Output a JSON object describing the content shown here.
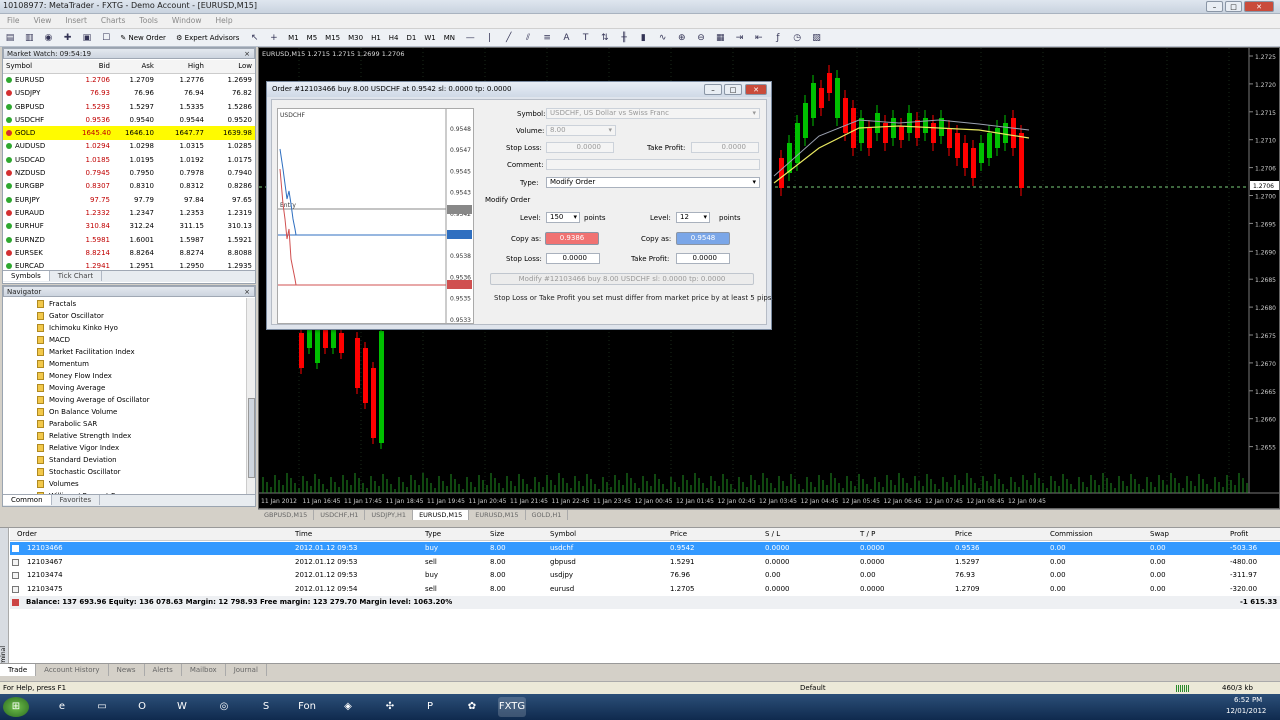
{
  "window": {
    "title": "10108977: MetaTrader - FXTG - Demo Account - [EURUSD,M15]"
  },
  "menu": [
    "File",
    "View",
    "Insert",
    "Charts",
    "Tools",
    "Window",
    "Help"
  ],
  "toolbar": {
    "new_order": "New Order",
    "expert_advisors": "Expert Advisors",
    "timeframes": [
      "M1",
      "M5",
      "M15",
      "M30",
      "H1",
      "H4",
      "D1",
      "W1",
      "MN"
    ]
  },
  "market_watch": {
    "title": "Market Watch: 09:54:19",
    "columns": [
      "Symbol",
      "Bid",
      "Ask",
      "High",
      "Low"
    ],
    "rows": [
      {
        "symbol": "EURUSD",
        "bid": "1.2706",
        "ask": "1.2709",
        "high": "1.2776",
        "low": "1.2699"
      },
      {
        "symbol": "USDJPY",
        "bid": "76.93",
        "ask": "76.96",
        "high": "76.94",
        "low": "76.82"
      },
      {
        "symbol": "GBPUSD",
        "bid": "1.5293",
        "ask": "1.5297",
        "high": "1.5335",
        "low": "1.5286"
      },
      {
        "symbol": "USDCHF",
        "bid": "0.9536",
        "ask": "0.9540",
        "high": "0.9544",
        "low": "0.9520"
      },
      {
        "symbol": "GOLD",
        "bid": "1645.40",
        "ask": "1646.10",
        "high": "1647.77",
        "low": "1639.98"
      },
      {
        "symbol": "AUDUSD",
        "bid": "1.0294",
        "ask": "1.0298",
        "high": "1.0315",
        "low": "1.0285"
      },
      {
        "symbol": "USDCAD",
        "bid": "1.0185",
        "ask": "1.0195",
        "high": "1.0192",
        "low": "1.0175"
      },
      {
        "symbol": "NZDUSD",
        "bid": "0.7945",
        "ask": "0.7950",
        "high": "0.7978",
        "low": "0.7940"
      },
      {
        "symbol": "EURGBP",
        "bid": "0.8307",
        "ask": "0.8310",
        "high": "0.8312",
        "low": "0.8286"
      },
      {
        "symbol": "EURJPY",
        "bid": "97.75",
        "ask": "97.79",
        "high": "97.84",
        "low": "97.65"
      },
      {
        "symbol": "EURAUD",
        "bid": "1.2332",
        "ask": "1.2347",
        "high": "1.2353",
        "low": "1.2319"
      },
      {
        "symbol": "EURHUF",
        "bid": "310.84",
        "ask": "312.24",
        "high": "311.15",
        "low": "310.13"
      },
      {
        "symbol": "EURNZD",
        "bid": "1.5981",
        "ask": "1.6001",
        "high": "1.5987",
        "low": "1.5921"
      },
      {
        "symbol": "EURSEK",
        "bid": "8.8214",
        "ask": "8.8264",
        "high": "8.8274",
        "low": "8.8088"
      },
      {
        "symbol": "EURCAD",
        "bid": "1.2941",
        "ask": "1.2951",
        "high": "1.2950",
        "low": "1.2935"
      }
    ],
    "tabs": [
      "Symbols",
      "Tick Chart"
    ]
  },
  "navigator": {
    "title": "Navigator",
    "items": [
      "Fractals",
      "Gator Oscillator",
      "Ichimoku Kinko Hyo",
      "MACD",
      "Market Facilitation Index",
      "Momentum",
      "Money Flow Index",
      "Moving Average",
      "Moving Average of Oscillator",
      "On Balance Volume",
      "Parabolic SAR",
      "Relative Strength Index",
      "Relative Vigor Index",
      "Standard Deviation",
      "Stochastic Oscillator",
      "Volumes",
      "Williams' Percent Range",
      "Expert Advisors"
    ],
    "tabs": [
      "Common",
      "Favorites"
    ]
  },
  "chart": {
    "title": "EURUSD,M15  1.2715 1.2715 1.2699 1.2706",
    "price_labels": [
      "1.2725",
      "1.2720",
      "1.2715",
      "1.2710",
      "1.2706",
      "1.2700",
      "1.2695",
      "1.2690",
      "1.2685",
      "1.2680",
      "1.2675",
      "1.2670",
      "1.2665",
      "1.2660",
      "1.2655"
    ],
    "time_labels": [
      "11 Jan 2012",
      "11 Jan 16:45",
      "11 Jan 17:45",
      "11 Jan 18:45",
      "11 Jan 19:45",
      "11 Jan 20:45",
      "11 Jan 21:45",
      "11 Jan 22:45",
      "11 Jan 23:45",
      "12 Jan 00:45",
      "12 Jan 01:45",
      "12 Jan 02:45",
      "12 Jan 03:45",
      "12 Jan 04:45",
      "12 Jan 05:45",
      "12 Jan 06:45",
      "12 Jan 07:45",
      "12 Jan 08:45",
      "12 Jan 09:45"
    ],
    "tabs": [
      "GBPUSD,M15",
      "USDCHF,H1",
      "USDJPY,H1",
      "EURUSD,M15",
      "EURUSD,M15",
      "GOLD,H1"
    ],
    "active_tab": 3
  },
  "dialog": {
    "title": "Order #12103466 buy 8.00 USDCHF at 0.9542 sl: 0.0000 tp: 0.0000",
    "symbol_label": "Symbol:",
    "symbol_value": "USDCHF, US Dollar vs Swiss Franc",
    "volume_label": "Volume:",
    "volume_value": "8.00",
    "stoploss_label": "Stop Loss:",
    "stoploss_value": "0.0000",
    "takeprofit_label": "Take Profit:",
    "takeprofit_value": "0.0000",
    "comment_label": "Comment:",
    "type_label": "Type:",
    "type_value": "Modify Order",
    "section": "Modify Order",
    "level_label": "Level:",
    "level_sl": "150",
    "level_tp": "12",
    "points": "points",
    "copy_as_label": "Copy as:",
    "copy_sl": "0.9386",
    "copy_tp": "0.9548",
    "stop_loss2_label": "Stop Loss:",
    "stop_loss2_value": "0.0000",
    "take_profit2_label": "Take Profit:",
    "take_profit2_value": "0.0000",
    "modify_button": "Modify #12103466 buy 8.00 USDCHF sl: 0.0000 tp: 0.0000",
    "note": "Stop Loss or Take Profit you set must differ from market price by at least 5 pips.",
    "mini_prices": [
      "0.9548",
      "0.9547",
      "0.9545",
      "0.9543",
      "0.9542",
      "0.9540",
      "0.9538",
      "0.9536",
      "0.9535",
      "0.9533"
    ],
    "mini_title": "USDCHF",
    "entry_label": "Entry"
  },
  "terminal": {
    "columns": [
      "Order",
      "Time",
      "Type",
      "Size",
      "Symbol",
      "Price",
      "S / L",
      "T / P",
      "Price",
      "Commission",
      "Swap",
      "Profit"
    ],
    "rows": [
      {
        "order": "12103466",
        "time": "2012.01.12 09:53",
        "type": "buy",
        "size": "8.00",
        "symbol": "usdchf",
        "price": "0.9542",
        "sl": "0.0000",
        "tp": "0.0000",
        "cur": "0.9536",
        "commission": "0.00",
        "swap": "0.00",
        "profit": "-503.36"
      },
      {
        "order": "12103467",
        "time": "2012.01.12 09:53",
        "type": "sell",
        "size": "8.00",
        "symbol": "gbpusd",
        "price": "1.5291",
        "sl": "0.0000",
        "tp": "0.0000",
        "cur": "1.5297",
        "commission": "0.00",
        "swap": "0.00",
        "profit": "-480.00"
      },
      {
        "order": "12103474",
        "time": "2012.01.12 09:53",
        "type": "buy",
        "size": "8.00",
        "symbol": "usdjpy",
        "price": "76.96",
        "sl": "0.00",
        "tp": "0.00",
        "cur": "76.93",
        "commission": "0.00",
        "swap": "0.00",
        "profit": "-311.97"
      },
      {
        "order": "12103475",
        "time": "2012.01.12 09:54",
        "type": "sell",
        "size": "8.00",
        "symbol": "eurusd",
        "price": "1.2705",
        "sl": "0.0000",
        "tp": "0.0000",
        "cur": "1.2709",
        "commission": "0.00",
        "swap": "0.00",
        "profit": "-320.00"
      }
    ],
    "balance": "Balance: 137 693.96  Equity: 136 078.63  Margin: 12 798.93  Free margin: 123 279.70  Margin level: 1063.20%",
    "total": "-1 615.33",
    "tabs": [
      "Trade",
      "Account History",
      "News",
      "Alerts",
      "Mailbox",
      "Journal"
    ],
    "side_label": "Terminal"
  },
  "status": {
    "help": "For Help, press F1",
    "profile": "Default",
    "traffic": "460/3 kb"
  },
  "taskbar": {
    "time": "6:52 PM",
    "date": "12/01/2012"
  },
  "colors": {
    "bull": "#00c000",
    "bear": "#ff0000",
    "selection": "#3399ff",
    "gold_row": "#fffb00"
  }
}
